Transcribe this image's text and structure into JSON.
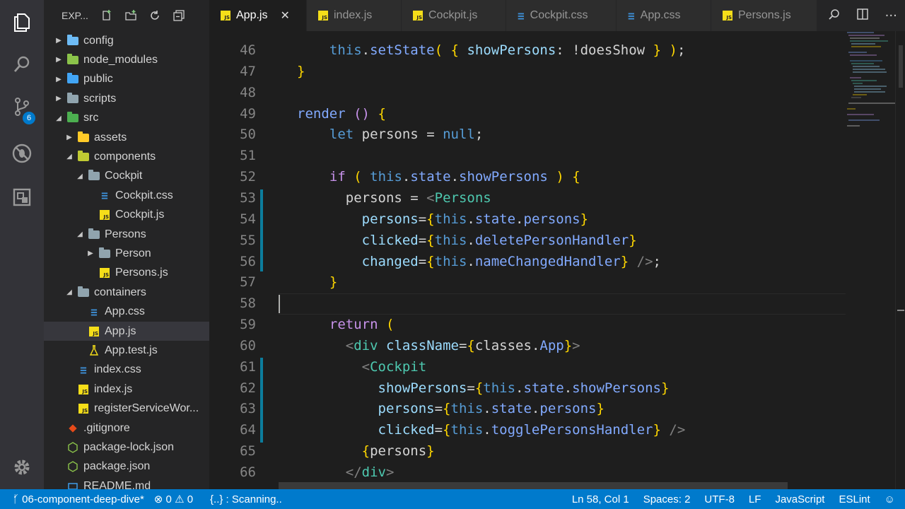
{
  "sidebar": {
    "title": "EXP...",
    "items": [
      {
        "label": "config",
        "type": "folder-closed",
        "color": "#6dbbf5"
      },
      {
        "label": "node_modules",
        "type": "folder-closed",
        "color": "#8bc34a"
      },
      {
        "label": "public",
        "type": "folder-closed",
        "color": "#42a5f5"
      },
      {
        "label": "scripts",
        "type": "folder-closed",
        "color": "#90a4ae"
      },
      {
        "label": "src",
        "type": "folder-open",
        "color": "#4caf50"
      },
      {
        "label": "assets",
        "type": "folder-closed",
        "color": "#ffca28"
      },
      {
        "label": "components",
        "type": "folder-open",
        "color": "#c0ca33"
      },
      {
        "label": "Cockpit",
        "type": "folder-open",
        "color": "#90a4ae"
      },
      {
        "label": "Cockpit.css",
        "type": "css"
      },
      {
        "label": "Cockpit.js",
        "type": "js"
      },
      {
        "label": "Persons",
        "type": "folder-open",
        "color": "#90a4ae"
      },
      {
        "label": "Person",
        "type": "folder-closed",
        "color": "#90a4ae"
      },
      {
        "label": "Persons.js",
        "type": "js"
      },
      {
        "label": "containers",
        "type": "folder-open",
        "color": "#90a4ae"
      },
      {
        "label": "App.css",
        "type": "css"
      },
      {
        "label": "App.js",
        "type": "js"
      },
      {
        "label": "App.test.js",
        "type": "test"
      },
      {
        "label": "index.css",
        "type": "css"
      },
      {
        "label": "index.js",
        "type": "js"
      },
      {
        "label": "registerServiceWor...",
        "type": "js"
      },
      {
        "label": ".gitignore",
        "type": "git"
      },
      {
        "label": "package-lock.json",
        "type": "node"
      },
      {
        "label": "package.json",
        "type": "node"
      },
      {
        "label": "README.md",
        "type": "md"
      }
    ]
  },
  "activity": {
    "scm_badge": "6"
  },
  "tabs": [
    {
      "label": "App.js",
      "icon": "js"
    },
    {
      "label": "index.js",
      "icon": "js"
    },
    {
      "label": "Cockpit.js",
      "icon": "js"
    },
    {
      "label": "Cockpit.css",
      "icon": "css"
    },
    {
      "label": "App.css",
      "icon": "css"
    },
    {
      "label": "Persons.js",
      "icon": "js"
    }
  ],
  "editor": {
    "line_numbers": [
      "46",
      "47",
      "48",
      "49",
      "50",
      "51",
      "52",
      "53",
      "54",
      "55",
      "56",
      "57",
      "58",
      "59",
      "60",
      "61",
      "62",
      "63",
      "64",
      "65",
      "66"
    ]
  },
  "status": {
    "branch": "06-component-deep-dive*",
    "errors": "0",
    "warnings": "0",
    "scanning": "{..} : Scanning..",
    "position": "Ln 58, Col 1",
    "spaces": "Spaces: 2",
    "encoding": "UTF-8",
    "eol": "LF",
    "language": "JavaScript",
    "linter": "ESLint"
  }
}
